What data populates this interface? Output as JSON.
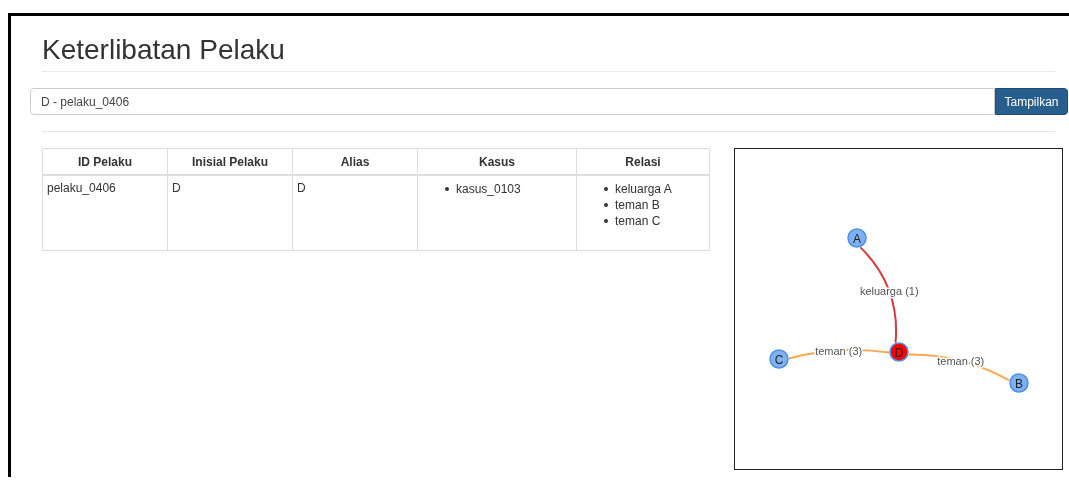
{
  "title": "Keterlibatan Pelaku",
  "search": {
    "value": "D - pelaku_0406",
    "button": "Tampilkan"
  },
  "table": {
    "columns": [
      "ID Pelaku",
      "Inisial Pelaku",
      "Alias",
      "Kasus",
      "Relasi"
    ],
    "rows": [
      {
        "id": "pelaku_0406",
        "initial": "D",
        "alias": "D",
        "cases": [
          "kasus_0103"
        ],
        "relations": [
          "keluarga A",
          "teman B",
          "teman C"
        ]
      }
    ]
  },
  "graph": {
    "nodes": [
      {
        "label": "A",
        "color": "#7eb2f5"
      },
      {
        "label": "D",
        "color": "#ff0000"
      },
      {
        "label": "C",
        "color": "#7eb2f5"
      },
      {
        "label": "B",
        "color": "#7eb2f5"
      }
    ],
    "edges": [
      {
        "label": "keluarga (1)",
        "color": "#d63b3b"
      },
      {
        "label": "teman (3)",
        "color": "#ffa64d"
      },
      {
        "label": "teman (3)",
        "color": "#ffa64d"
      }
    ]
  }
}
